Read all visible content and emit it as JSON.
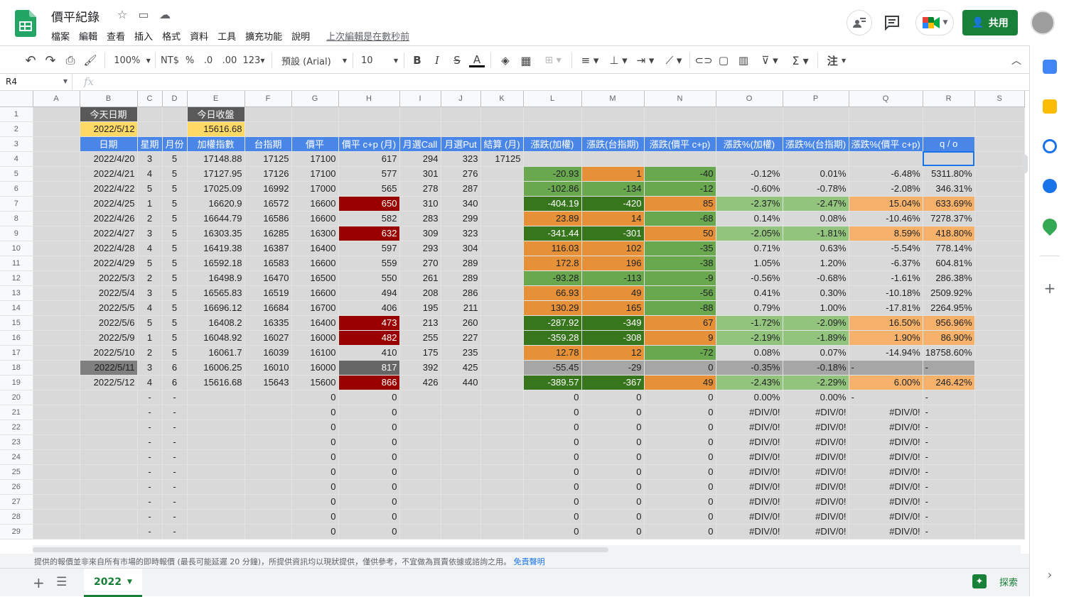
{
  "doc": {
    "title": "價平紀錄",
    "last_edit": "上次編輯是在數秒前"
  },
  "menu": [
    "檔案",
    "編輯",
    "查看",
    "插入",
    "格式",
    "資料",
    "工具",
    "擴充功能",
    "說明"
  ],
  "share_label": "共用",
  "toolbar": {
    "zoom": "100%",
    "currency": "NT$",
    "percent": "%",
    "dec_less": ".0",
    "dec_more": ".00",
    "format": "123",
    "font": "預設 (Arial)",
    "font_size": "10",
    "input_tools": "注"
  },
  "name_box": "R4",
  "fx": "fx",
  "columns": [
    "A",
    "B",
    "C",
    "D",
    "E",
    "F",
    "G",
    "H",
    "I",
    "J",
    "K",
    "L",
    "M",
    "N",
    "O",
    "P",
    "Q",
    "R",
    "S"
  ],
  "rows": [
    [
      "",
      "今天日期",
      "",
      "",
      "今日收盤",
      "",
      "",
      "",
      "",
      "",
      "",
      "",
      "",
      "",
      "",
      "",
      "",
      "",
      ""
    ],
    [
      "",
      "2022/5/12",
      "",
      "",
      "15616.68",
      "",
      "",
      "",
      "",
      "",
      "",
      "",
      "",
      "",
      "",
      "",
      "",
      "",
      ""
    ],
    [
      "",
      "日期",
      "星期",
      "月份",
      "加權指數",
      "台指期",
      "價平",
      "價平 c+p (月)",
      "月選Call",
      "月選Put",
      "結算 (月)",
      "漲跌(加權)",
      "漲跌(台指期)",
      "漲跌(價平 c+p)",
      "漲跌%(加權)",
      "漲跌%(台指期)",
      "漲跌%(價平 c+p)",
      "q / o",
      ""
    ],
    [
      "",
      "2022/4/20",
      "3",
      "5",
      "17148.88",
      "17125",
      "17100",
      "617",
      "294",
      "323",
      "17125",
      "",
      "",
      "",
      "",
      "",
      "",
      "",
      ""
    ],
    [
      "",
      "2022/4/21",
      "4",
      "5",
      "17127.95",
      "17126",
      "17100",
      "577",
      "301",
      "276",
      "",
      "-20.93",
      "1",
      "-40",
      "-0.12%",
      "0.01%",
      "-6.48%",
      "5311.80%",
      ""
    ],
    [
      "",
      "2022/4/22",
      "5",
      "5",
      "17025.09",
      "16992",
      "17000",
      "565",
      "278",
      "287",
      "",
      "-102.86",
      "-134",
      "-12",
      "-0.60%",
      "-0.78%",
      "-2.08%",
      "346.31%",
      ""
    ],
    [
      "",
      "2022/4/25",
      "1",
      "5",
      "16620.9",
      "16572",
      "16600",
      "650",
      "310",
      "340",
      "",
      "-404.19",
      "-420",
      "85",
      "-2.37%",
      "-2.47%",
      "15.04%",
      "633.69%",
      ""
    ],
    [
      "",
      "2022/4/26",
      "2",
      "5",
      "16644.79",
      "16586",
      "16600",
      "582",
      "283",
      "299",
      "",
      "23.89",
      "14",
      "-68",
      "0.14%",
      "0.08%",
      "-10.46%",
      "7278.37%",
      ""
    ],
    [
      "",
      "2022/4/27",
      "3",
      "5",
      "16303.35",
      "16285",
      "16300",
      "632",
      "309",
      "323",
      "",
      "-341.44",
      "-301",
      "50",
      "-2.05%",
      "-1.81%",
      "8.59%",
      "418.80%",
      ""
    ],
    [
      "",
      "2022/4/28",
      "4",
      "5",
      "16419.38",
      "16387",
      "16400",
      "597",
      "293",
      "304",
      "",
      "116.03",
      "102",
      "-35",
      "0.71%",
      "0.63%",
      "-5.54%",
      "778.14%",
      ""
    ],
    [
      "",
      "2022/4/29",
      "5",
      "5",
      "16592.18",
      "16583",
      "16600",
      "559",
      "270",
      "289",
      "",
      "172.8",
      "196",
      "-38",
      "1.05%",
      "1.20%",
      "-6.37%",
      "604.81%",
      ""
    ],
    [
      "",
      "2022/5/3",
      "2",
      "5",
      "16498.9",
      "16470",
      "16500",
      "550",
      "261",
      "289",
      "",
      "-93.28",
      "-113",
      "-9",
      "-0.56%",
      "-0.68%",
      "-1.61%",
      "286.38%",
      ""
    ],
    [
      "",
      "2022/5/4",
      "3",
      "5",
      "16565.83",
      "16519",
      "16600",
      "494",
      "208",
      "286",
      "",
      "66.93",
      "49",
      "-56",
      "0.41%",
      "0.30%",
      "-10.18%",
      "2509.92%",
      ""
    ],
    [
      "",
      "2022/5/5",
      "4",
      "5",
      "16696.12",
      "16684",
      "16700",
      "406",
      "195",
      "211",
      "",
      "130.29",
      "165",
      "-88",
      "0.79%",
      "1.00%",
      "-17.81%",
      "2264.95%",
      ""
    ],
    [
      "",
      "2022/5/6",
      "5",
      "5",
      "16408.2",
      "16335",
      "16400",
      "473",
      "213",
      "260",
      "",
      "-287.92",
      "-349",
      "67",
      "-1.72%",
      "-2.09%",
      "16.50%",
      "956.96%",
      ""
    ],
    [
      "",
      "2022/5/9",
      "1",
      "5",
      "16048.92",
      "16027",
      "16000",
      "482",
      "255",
      "227",
      "",
      "-359.28",
      "-308",
      "9",
      "-2.19%",
      "-1.89%",
      "1.90%",
      "86.90%",
      ""
    ],
    [
      "",
      "2022/5/10",
      "2",
      "5",
      "16061.7",
      "16039",
      "16100",
      "410",
      "175",
      "235",
      "",
      "12.78",
      "12",
      "-72",
      "0.08%",
      "0.07%",
      "-14.94%",
      "18758.60%",
      ""
    ],
    [
      "",
      "2022/5/11",
      "3",
      "6",
      "16006.25",
      "16010",
      "16000",
      "817",
      "392",
      "425",
      "",
      "-55.45",
      "-29",
      "0",
      "-0.35%",
      "-0.18%",
      "-",
      "-",
      ""
    ],
    [
      "",
      "2022/5/12",
      "4",
      "6",
      "15616.68",
      "15643",
      "15600",
      "866",
      "426",
      "440",
      "",
      "-389.57",
      "-367",
      "49",
      "-2.43%",
      "-2.29%",
      "6.00%",
      "246.42%",
      ""
    ],
    [
      "",
      "",
      "-",
      "-",
      "",
      "",
      "0",
      "0",
      "",
      "",
      "",
      "0",
      "0",
      "0",
      "0.00%",
      "0.00%",
      "-",
      "-",
      ""
    ],
    [
      "",
      "",
      "-",
      "-",
      "",
      "",
      "0",
      "0",
      "",
      "",
      "",
      "0",
      "0",
      "0",
      "#DIV/0!",
      "#DIV/0!",
      "#DIV/0!",
      "-",
      ""
    ],
    [
      "",
      "",
      "-",
      "-",
      "",
      "",
      "0",
      "0",
      "",
      "",
      "",
      "0",
      "0",
      "0",
      "#DIV/0!",
      "#DIV/0!",
      "#DIV/0!",
      "-",
      ""
    ],
    [
      "",
      "",
      "-",
      "-",
      "",
      "",
      "0",
      "0",
      "",
      "",
      "",
      "0",
      "0",
      "0",
      "#DIV/0!",
      "#DIV/0!",
      "#DIV/0!",
      "-",
      ""
    ],
    [
      "",
      "",
      "-",
      "-",
      "",
      "",
      "0",
      "0",
      "",
      "",
      "",
      "0",
      "0",
      "0",
      "#DIV/0!",
      "#DIV/0!",
      "#DIV/0!",
      "-",
      ""
    ],
    [
      "",
      "",
      "-",
      "-",
      "",
      "",
      "0",
      "0",
      "",
      "",
      "",
      "0",
      "0",
      "0",
      "#DIV/0!",
      "#DIV/0!",
      "#DIV/0!",
      "-",
      ""
    ],
    [
      "",
      "",
      "-",
      "-",
      "",
      "",
      "0",
      "0",
      "",
      "",
      "",
      "0",
      "0",
      "0",
      "#DIV/0!",
      "#DIV/0!",
      "#DIV/0!",
      "-",
      ""
    ],
    [
      "",
      "",
      "-",
      "-",
      "",
      "",
      "0",
      "0",
      "",
      "",
      "",
      "0",
      "0",
      "0",
      "#DIV/0!",
      "#DIV/0!",
      "#DIV/0!",
      "-",
      ""
    ],
    [
      "",
      "",
      "-",
      "-",
      "",
      "",
      "0",
      "0",
      "",
      "",
      "",
      "0",
      "0",
      "0",
      "#DIV/0!",
      "#DIV/0!",
      "#DIV/0!",
      "-",
      ""
    ],
    [
      "",
      "",
      "-",
      "-",
      "",
      "",
      "0",
      "0",
      "",
      "",
      "",
      "0",
      "0",
      "0",
      "#DIV/0!",
      "#DIV/0!",
      "#DIV/0!",
      "-",
      ""
    ]
  ],
  "disclaimer": "提供的報價並非來自所有市場的即時報價 (最長可能延遲 20 分鐘)，所提供資訊均以現狀提供，僅供參考，不宜做為買賣依據或諮詢之用。",
  "disclaimer_link": "免責聲明",
  "sheet_tab": "2022",
  "explore_label": "探索",
  "colors": {
    "header_blue": "#4a86e8",
    "gold": "#ffd966",
    "dark": "#7f7f7f",
    "green_dark": "#38761d",
    "green": "#6aa84f",
    "green_light": "#93c47d",
    "orange": "#e69138",
    "orange_light": "#f6b26b",
    "red_dark": "#990000",
    "share_green": "#188038"
  }
}
